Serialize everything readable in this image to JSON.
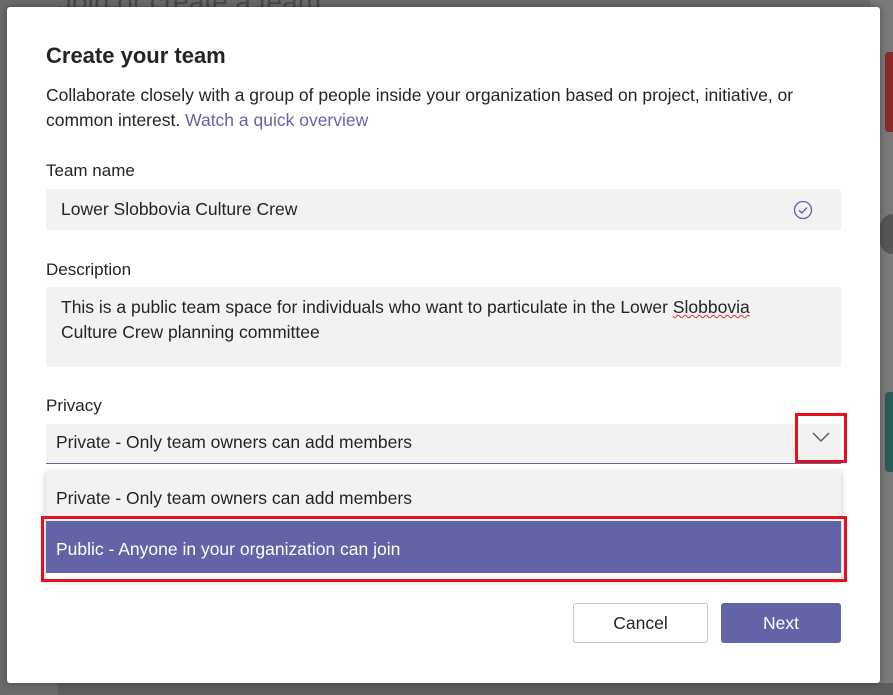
{
  "background": {
    "title": "Join or create a team"
  },
  "dialog": {
    "title": "Create your team",
    "description": "Collaborate closely with a group of people inside your organization based on project, initiative, or common interest.",
    "overview_link": "Watch a quick overview",
    "team_name": {
      "label": "Team name",
      "value": "Lower Slobbovia Culture Crew",
      "status_icon": "check-circle-icon"
    },
    "description_field": {
      "label": "Description",
      "value_part1": "This is a public team space for individuals who want to particulate in the Lower ",
      "value_misspelled": "Slobbovia",
      "value_part2": "Culture Crew planning committee"
    },
    "privacy": {
      "label": "Privacy",
      "selected": "Private - Only team owners can add members",
      "options": [
        "Private - Only team owners can add members",
        "Public - Anyone in your organization can join"
      ],
      "highlighted_option": "Public - Anyone in your organization can join"
    },
    "buttons": {
      "cancel": "Cancel",
      "next": "Next"
    }
  },
  "colors": {
    "accent": "#6264a7",
    "highlight_box": "#e3111c",
    "field_bg": "#f3f2f1"
  }
}
